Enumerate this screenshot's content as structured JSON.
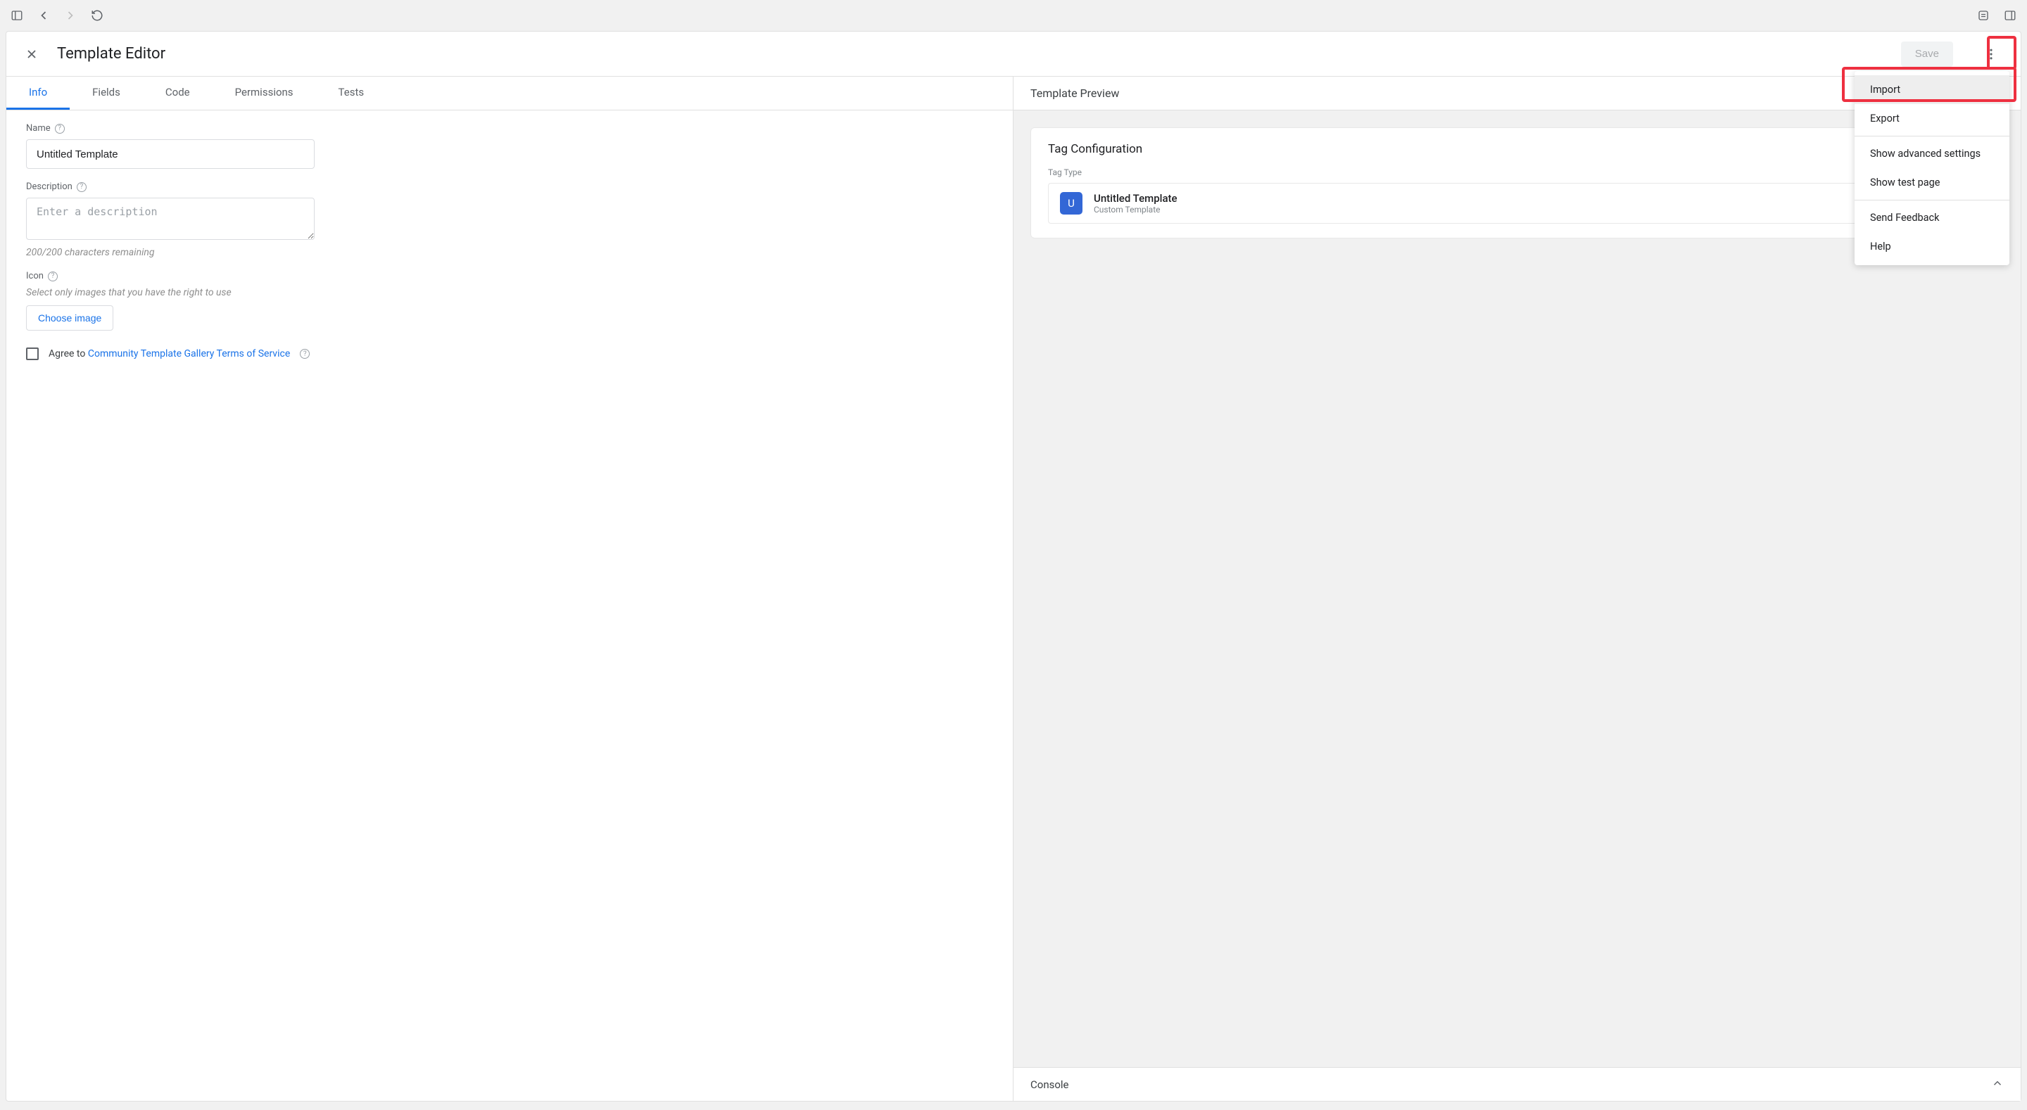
{
  "header": {
    "title": "Template Editor",
    "save_label": "Save"
  },
  "tabs": {
    "info": "Info",
    "fields": "Fields",
    "code": "Code",
    "permissions": "Permissions",
    "tests": "Tests"
  },
  "form": {
    "name_label": "Name",
    "name_value": "Untitled Template",
    "description_label": "Description",
    "description_placeholder": "Enter a description",
    "char_counter": "200/200 characters remaining",
    "icon_label": "Icon",
    "icon_hint": "Select only images that you have the right to use",
    "choose_image_label": "Choose image",
    "agree_prefix": "Agree to ",
    "agree_link": "Community Template Gallery Terms of Service"
  },
  "preview": {
    "title": "Template Preview",
    "card_title": "Tag Configuration",
    "tag_type_label": "Tag Type",
    "template_name": "Untitled Template",
    "template_sub": "Custom Template",
    "badge_letter": "U"
  },
  "console": {
    "title": "Console"
  },
  "menu": {
    "import": "Import",
    "export": "Export",
    "advanced": "Show advanced settings",
    "test_page": "Show test page",
    "feedback": "Send Feedback",
    "help": "Help"
  }
}
